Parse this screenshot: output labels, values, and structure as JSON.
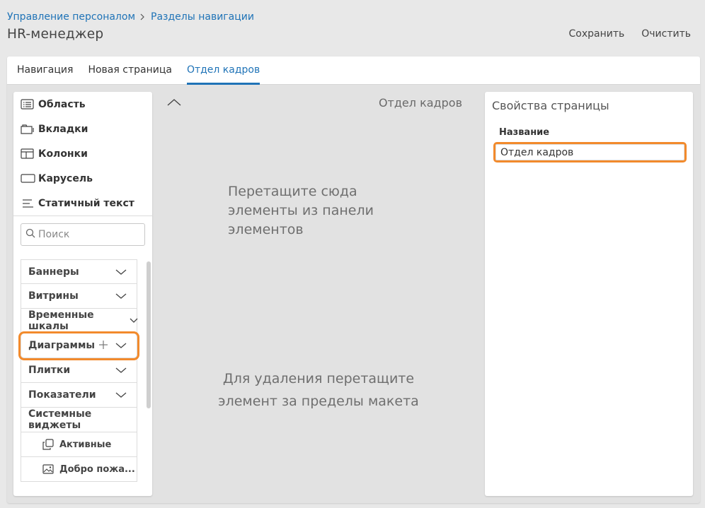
{
  "breadcrumb": {
    "items": [
      "Управление персоналом",
      "Разделы навигации"
    ]
  },
  "page_title": "HR-менеджер",
  "actions": {
    "save": "Сохранить",
    "clear": "Очистить"
  },
  "tabs": [
    {
      "label": "Навигация",
      "active": false
    },
    {
      "label": "Новая страница",
      "active": false
    },
    {
      "label": "Отдел кадров",
      "active": true
    }
  ],
  "layout_items": [
    {
      "label": "Область",
      "icon": "list-icon"
    },
    {
      "label": "Вкладки",
      "icon": "folder-tabs-icon"
    },
    {
      "label": "Колонки",
      "icon": "columns-icon"
    },
    {
      "label": "Карусель",
      "icon": "carousel-icon"
    },
    {
      "label": "Статичный текст",
      "icon": "text-lines-icon"
    }
  ],
  "search": {
    "placeholder": "Поиск"
  },
  "groups": [
    {
      "label": "Баннеры"
    },
    {
      "label": "Витрины"
    },
    {
      "label": "Временные шкалы"
    },
    {
      "label": "Диаграммы",
      "highlighted": true
    },
    {
      "label": "Плитки"
    },
    {
      "label": "Показатели"
    },
    {
      "label": "Системные виджеты",
      "expanded": true
    }
  ],
  "system_widgets": [
    {
      "label": "Активные",
      "icon": "copy-icon"
    },
    {
      "label": "Добро пожа...",
      "icon": "image-icon"
    }
  ],
  "canvas": {
    "page_name": "Отдел кадров",
    "drop_hint": "Перетащите сюда элементы из панели элементов",
    "delete_hint": "Для удаления перетащите элемент за пределы макета"
  },
  "properties": {
    "title": "Свойства страницы",
    "name_label": "Название",
    "name_value": "Отдел кадров"
  },
  "colors": {
    "accent": "#1f73b7",
    "highlight": "#f28a2c"
  }
}
